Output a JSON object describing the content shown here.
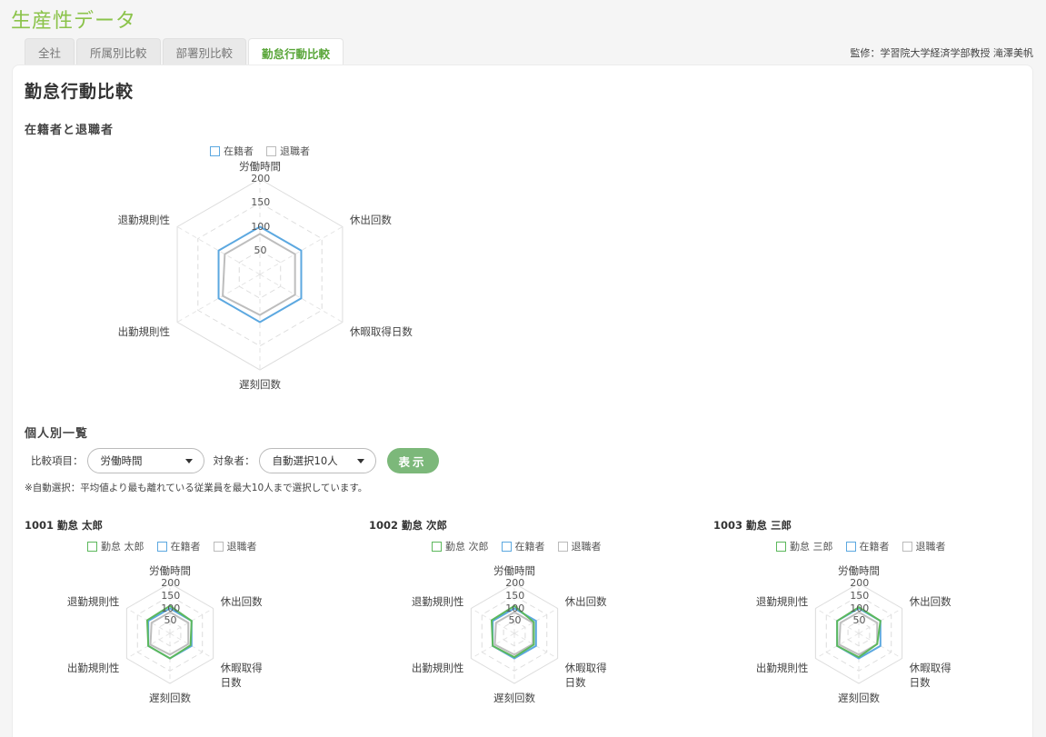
{
  "app_title": "生産性データ",
  "tabs": [
    {
      "label": "全社",
      "active": false
    },
    {
      "label": "所属別比較",
      "active": false
    },
    {
      "label": "部署別比較",
      "active": false
    },
    {
      "label": "勤怠行動比較",
      "active": true
    }
  ],
  "supervisor": "監修：学習院大学経済学部教授 滝澤美帆",
  "page_title": "勤怠行動比較",
  "colors": {
    "accent": "#8bc34a",
    "current": "#5ca8e0",
    "retired": "#bdbdbd",
    "employee": "#5cb85c"
  },
  "section_overall": "在籍者と退職者",
  "section_individual": "個人別一覧",
  "legend_current": "在籍者",
  "legend_retired": "退職者",
  "axes": [
    "労働時間",
    "休出回数",
    "休暇取得日数",
    "遅刻回数",
    "出勤規則性",
    "退勤規則性"
  ],
  "axes_small": [
    "労働時間",
    "休出回数",
    "休暇取得\n日数",
    "遅刻回数",
    "出勤規則性",
    "退勤規則性"
  ],
  "ticks": [
    "50",
    "100",
    "150",
    "200"
  ],
  "controls": {
    "compare_label": "比較項目：",
    "compare_value": "労働時間",
    "target_label": "対象者：",
    "target_value": "自動選択10人",
    "show_button": "表示"
  },
  "note": "※自動選択：平均値より最も離れている従業員を最大10人まで選択しています。",
  "chart_data": [
    {
      "type": "radar",
      "title": "在籍者と退職者",
      "axes": [
        "労働時間",
        "休出回数",
        "休暇取得日数",
        "遅刻回数",
        "出勤規則性",
        "退勤規則性"
      ],
      "rmax": 200,
      "ticks": [
        50,
        100,
        150,
        200
      ],
      "series": [
        {
          "name": "在籍者",
          "values": [
            100,
            100,
            100,
            100,
            100,
            100
          ]
        },
        {
          "name": "退職者",
          "values": [
            85,
            85,
            85,
            85,
            90,
            85
          ]
        }
      ]
    },
    {
      "type": "radar",
      "title": "1001 勤怠 太郎",
      "axes": [
        "労働時間",
        "休出回数",
        "休暇取得日数",
        "遅刻回数",
        "出勤規則性",
        "退勤規則性"
      ],
      "rmax": 200,
      "ticks": [
        50,
        100,
        150,
        200
      ],
      "series": [
        {
          "name": "勤怠 太郎",
          "values": [
            110,
            100,
            95,
            100,
            100,
            105
          ]
        },
        {
          "name": "在籍者",
          "values": [
            100,
            100,
            100,
            100,
            100,
            100
          ]
        },
        {
          "name": "退職者",
          "values": [
            85,
            85,
            85,
            85,
            90,
            85
          ]
        }
      ]
    },
    {
      "type": "radar",
      "title": "1002 勤怠 次郎",
      "axes": [
        "労働時間",
        "休出回数",
        "休暇取得日数",
        "遅刻回数",
        "出勤規則性",
        "退勤規則性"
      ],
      "rmax": 200,
      "ticks": [
        50,
        100,
        150,
        200
      ],
      "series": [
        {
          "name": "勤怠 次郎",
          "values": [
            110,
            90,
            90,
            95,
            100,
            105
          ]
        },
        {
          "name": "在籍者",
          "values": [
            100,
            100,
            100,
            100,
            100,
            100
          ]
        },
        {
          "name": "退職者",
          "values": [
            85,
            85,
            85,
            85,
            90,
            85
          ]
        }
      ]
    },
    {
      "type": "radar",
      "title": "1003 勤怠 三郎",
      "axes": [
        "労働時間",
        "休出回数",
        "休暇取得日数",
        "遅刻回数",
        "出勤規則性",
        "退勤規則性"
      ],
      "rmax": 200,
      "ticks": [
        50,
        100,
        150,
        200
      ],
      "series": [
        {
          "name": "勤怠 三郎",
          "values": [
            105,
            100,
            85,
            95,
            100,
            100
          ]
        },
        {
          "name": "在籍者",
          "values": [
            100,
            100,
            100,
            100,
            100,
            100
          ]
        },
        {
          "name": "退職者",
          "values": [
            85,
            85,
            85,
            85,
            90,
            85
          ]
        }
      ]
    }
  ]
}
